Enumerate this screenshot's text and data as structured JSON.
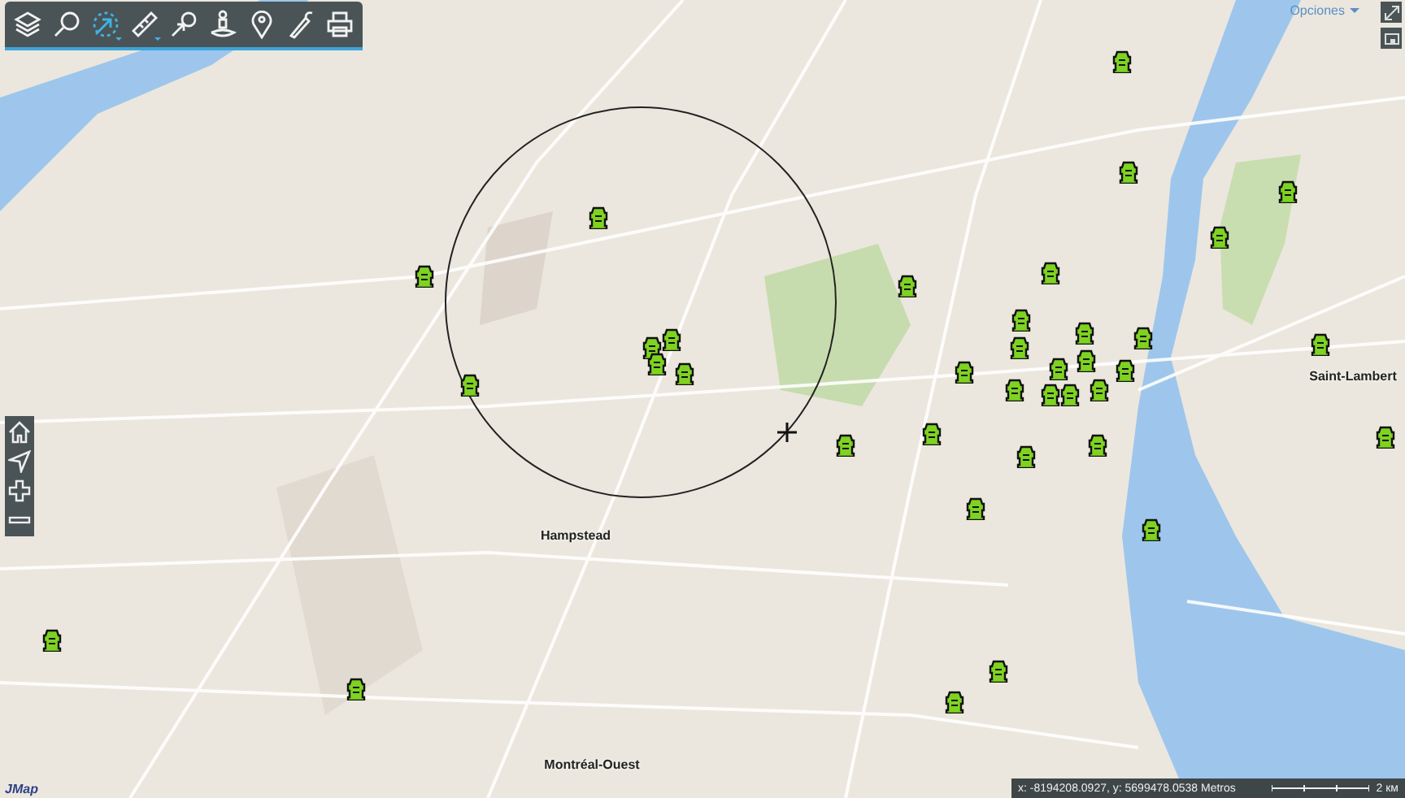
{
  "toolbar": {
    "tools": [
      {
        "selected": false,
        "has_menu": false
      },
      {
        "selected": false,
        "has_menu": false
      },
      {
        "selected": true,
        "has_menu": true
      },
      {
        "selected": false,
        "has_menu": true
      },
      {
        "selected": false,
        "has_menu": false
      },
      {
        "selected": false,
        "has_menu": false
      },
      {
        "selected": false,
        "has_menu": false
      },
      {
        "selected": false,
        "has_menu": false
      },
      {
        "selected": false,
        "has_menu": false
      }
    ]
  },
  "options_menu": {
    "label": "Opciones"
  },
  "map": {
    "place_labels": [
      {
        "text": "Hampstead"
      },
      {
        "text": "Montréal-Ouest"
      },
      {
        "text": "Saint-Lambert"
      }
    ]
  },
  "status_bar": {
    "coordinates": "x: -8194208.0927, y: 5699478.0538 Metros",
    "scale": "2 км"
  },
  "logo": "JMap"
}
